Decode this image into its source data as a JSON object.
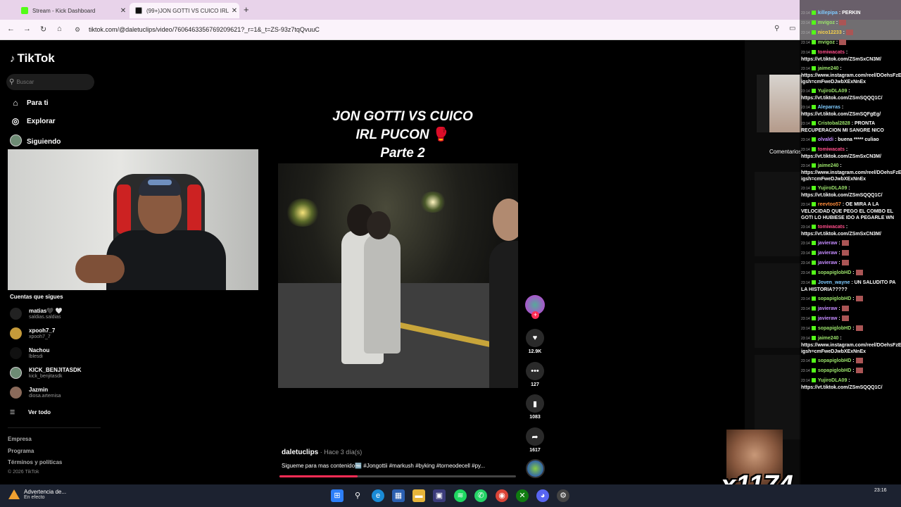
{
  "browser": {
    "tabs": [
      {
        "label": "Stream - Kick Dashboard",
        "active": false,
        "favicon_color": "#53fc18"
      },
      {
        "label": "(99+)JON GOTTI VS CUICO IRL",
        "active": true,
        "favicon_color": "#111111"
      }
    ],
    "new_tab": "+",
    "url": "tiktok.com/@daletuclips/video/7606463356769209621?_r=1&_t=ZS-93z7tqQvuuC"
  },
  "tiktok": {
    "logo": "TikTok",
    "search_placeholder": "Buscar",
    "nav": [
      {
        "label": "Para ti",
        "icon": "home-icon"
      },
      {
        "label": "Explorar",
        "icon": "compass-icon"
      },
      {
        "label": "Siguiendo",
        "icon": "avatar"
      }
    ],
    "following_title": "Cuentas que sigues",
    "following": [
      {
        "name": "matias🖤 🤍",
        "handle": "saldias.saldias",
        "color": "#222222"
      },
      {
        "name": "xpooh7_7",
        "handle": "xpooh7_7",
        "color": "#c49a3a"
      },
      {
        "name": "Nachou",
        "handle": "lblesdi",
        "color": "#111111"
      },
      {
        "name": "KICK_BENJITASDK",
        "handle": "kick_benjitasdk",
        "color": "#6d8b74"
      },
      {
        "name": "Jazmin",
        "handle": "diosa.artemisa",
        "color": "#8a6a5a"
      }
    ],
    "see_all": "Ver todo",
    "footer": [
      "Empresa",
      "Programa",
      "Términos y políticas"
    ],
    "copyright": "© 2026 TikTok"
  },
  "video": {
    "title_lines": [
      "JON GOTTI VS CUICO",
      "IRL PUCON",
      "Parte 2"
    ],
    "glove": "🥊",
    "author": "daletuclips",
    "time": " · Hace 3 día(s)",
    "description": "Sigueme para mas contenido🆓 #Jongottii #markush #byking #torneodecell #py...",
    "progress": 0.33,
    "likes": "12.9K",
    "comments": "127",
    "saves": "1083",
    "shares": "1617"
  },
  "sidebar_right": {
    "comments_label": "Comentarios"
  },
  "chat": [
    {
      "user": "killepipa",
      "text": "PERKIN",
      "color": "#7ecbff"
    },
    {
      "user": "mvigoz",
      "text": "",
      "color": "#9be36a"
    },
    {
      "user": "nico12233",
      "text": "",
      "color": "#f7d24a"
    },
    {
      "user": "mvigoz",
      "text": "",
      "color": "#9be36a"
    },
    {
      "user": "tomiwacats",
      "text": "https://vt.tiktok.com/ZSmSxCN3M/",
      "color": "#ff4d8a"
    },
    {
      "user": "jaime240",
      "text": "https://www.instagram.com/reel/DOehsFzEh3L/?igsh=cmFweDJwbXExNnEx",
      "color": "#9be36a"
    },
    {
      "user": "YujiroDLA09",
      "text": "https://vt.tiktok.com/ZSmSQQQ1C/",
      "color": "#9be36a"
    },
    {
      "user": "Aleparras",
      "text": "https://vt.tiktok.com/ZSmSQFgEg/",
      "color": "#7ecbff"
    },
    {
      "user": "Cristobal2828",
      "text": "PRONTA RECUPERACION MI SANGRE NICO",
      "color": "#9be36a"
    },
    {
      "user": "olvaldi",
      "text": "buena ***** culiao",
      "color": "#c58cff"
    },
    {
      "user": "tomiwacats",
      "text": "https://vt.tiktok.com/ZSmSxCN3M/",
      "color": "#ff4d8a"
    },
    {
      "user": "jaime240",
      "text": "https://www.instagram.com/reel/DOehsFzEh3L/?igsh=cmFweDJwbXExNnEx",
      "color": "#9be36a"
    },
    {
      "user": "YujiroDLA09",
      "text": "https://vt.tiktok.com/ZSmSQQQ1C/",
      "color": "#9be36a"
    },
    {
      "user": "reevtoo57",
      "text": "OE MIRA A LA VELOCIDAD QUE PEGO EL COMBO EL GOTI LO HUBIESE IDO A PEGARLE WN",
      "color": "#ff8c3a"
    },
    {
      "user": "tomiwacats",
      "text": "https://vt.tiktok.com/ZSmSxCN3M/",
      "color": "#ff4d8a"
    },
    {
      "user": "javieraw",
      "text": "",
      "color": "#c58cff"
    },
    {
      "user": "javieraw",
      "text": "",
      "color": "#c58cff"
    },
    {
      "user": "javieraw",
      "text": "",
      "color": "#c58cff"
    },
    {
      "user": "sopapiglobHD",
      "text": "",
      "color": "#9be36a"
    },
    {
      "user": "Joven_wayne",
      "text": "UN SALUDITO PA LA HISTORIA?????",
      "color": "#7ecbff"
    },
    {
      "user": "sopapiglobHD",
      "text": "",
      "color": "#9be36a"
    },
    {
      "user": "javieraw",
      "text": "",
      "color": "#c58cff"
    },
    {
      "user": "javieraw",
      "text": "",
      "color": "#c58cff"
    },
    {
      "user": "sopapiglobHD",
      "text": "",
      "color": "#9be36a"
    },
    {
      "user": "jaime240",
      "text": "https://www.instagram.com/reel/DOehsFzEh3L/?igsh=cmFweDJwbXExNnEx",
      "color": "#9be36a"
    },
    {
      "user": "sopapiglobHD",
      "text": "",
      "color": "#9be36a"
    },
    {
      "user": "sopapiglobHD",
      "text": "",
      "color": "#9be36a"
    },
    {
      "user": "YujiroDLA09",
      "text": "https://vt.tiktok.com/ZSmSQQQ1C/",
      "color": "#9be36a"
    }
  ],
  "chat_time": "23:14",
  "overlay": {
    "multiplier": "x1174"
  },
  "taskbar": {
    "alert_title": "Advertencia de...",
    "alert_sub": "En efecto",
    "time": "23:16"
  }
}
